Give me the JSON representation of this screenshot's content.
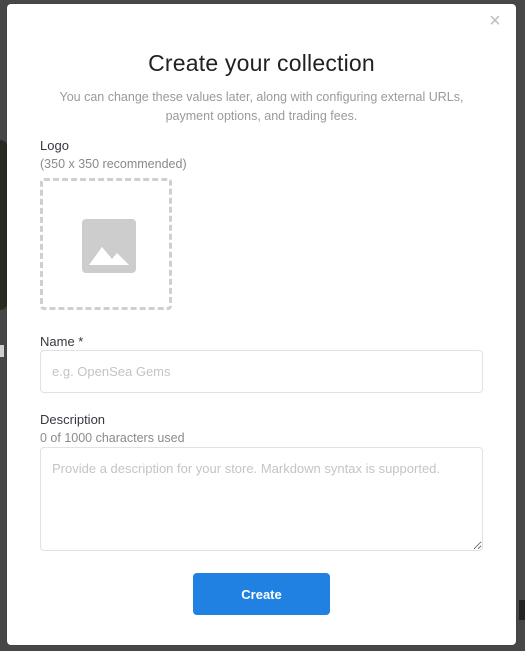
{
  "modal": {
    "title": "Create your collection",
    "subtitle": "You can change these values later, along with configuring external URLs, payment options, and trading fees.",
    "close_icon": "close-icon"
  },
  "logo": {
    "label": "Logo",
    "hint": "(350 x 350 recommended)",
    "icon": "image-placeholder-icon"
  },
  "name": {
    "label": "Name *",
    "placeholder": "e.g. OpenSea Gems",
    "value": ""
  },
  "description": {
    "label": "Description",
    "counter": "0 of 1000 characters used",
    "placeholder": "Provide a description for your store. Markdown syntax is supported.",
    "value": ""
  },
  "actions": {
    "create_label": "Create"
  },
  "colors": {
    "accent": "#2081e2",
    "overlay": "#474747"
  }
}
